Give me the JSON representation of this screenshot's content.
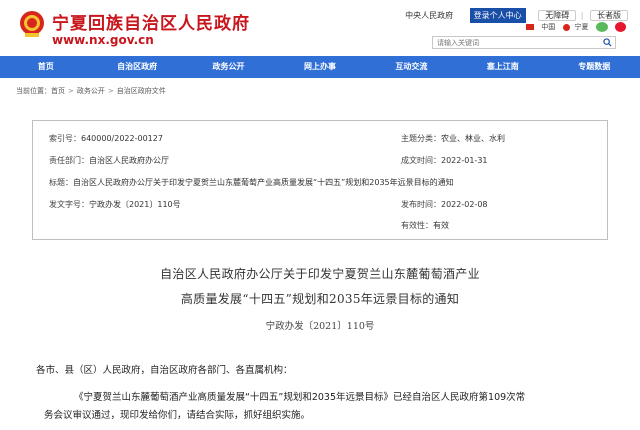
{
  "site": {
    "title": "宁夏回族自治区人民政府",
    "url": "www.nx.gov.cn"
  },
  "top_bar": {
    "gov_link": "中央人民政府",
    "login": "登录个人中心",
    "accessibility": "无障碍",
    "elder_mode": "长者版",
    "china_label": "中国",
    "ningxia_label": "宁夏",
    "search_placeholder": "请输入关键词"
  },
  "nav": [
    "首页",
    "自治区政府",
    "政务公开",
    "网上办事",
    "互动交流",
    "塞上江南",
    "专题数据"
  ],
  "breadcrumb": {
    "label": "当前位置：",
    "items": [
      "首页",
      "政务公开",
      "自治区政府文件"
    ]
  },
  "info": {
    "index_label": "索引号：",
    "index_value": "640000/2022-00127",
    "category_label": "主题分类：",
    "category_value": "农业、林业、水利",
    "dept_label": "责任部门：",
    "dept_value": "自治区人民政府办公厅",
    "created_label": "成文时间：",
    "created_value": "2022-01-31",
    "title_label": "标题：",
    "title_value": "自治区人民政府办公厅关于印发宁夏贺兰山东麓葡萄产业高质量发展“十四五”规划和2035年远景目标的通知",
    "docno_label": "发文字号：",
    "docno_value": "宁政办发〔2021〕110号",
    "published_label": "发布时间：",
    "published_value": "2022-02-08",
    "validity_label": "有效性：",
    "validity_value": "有效"
  },
  "article": {
    "title_line1": "自治区人民政府办公厅关于印发宁夏贺兰山东麓葡萄酒产业",
    "title_line2": "高质量发展“十四五”规划和2035年远景目标的通知",
    "doc_number": "宁政办发〔2021〕110号",
    "salutation": "各市、县（区）人民政府，自治区政府各部门、各直属机构：",
    "para1_line1": "《宁夏贺兰山东麓葡萄酒产业高质量发展“十四五”规划和2035年远景目标》已经自治区人民政府第109次常",
    "para1_line2": "务会议审议通过，现印发给你们，请结合实际，抓好组织实施。"
  },
  "colors": {
    "brand_red": "#c8161d",
    "nav_blue": "#2f6fd6",
    "login_blue": "#1a4fa8"
  }
}
